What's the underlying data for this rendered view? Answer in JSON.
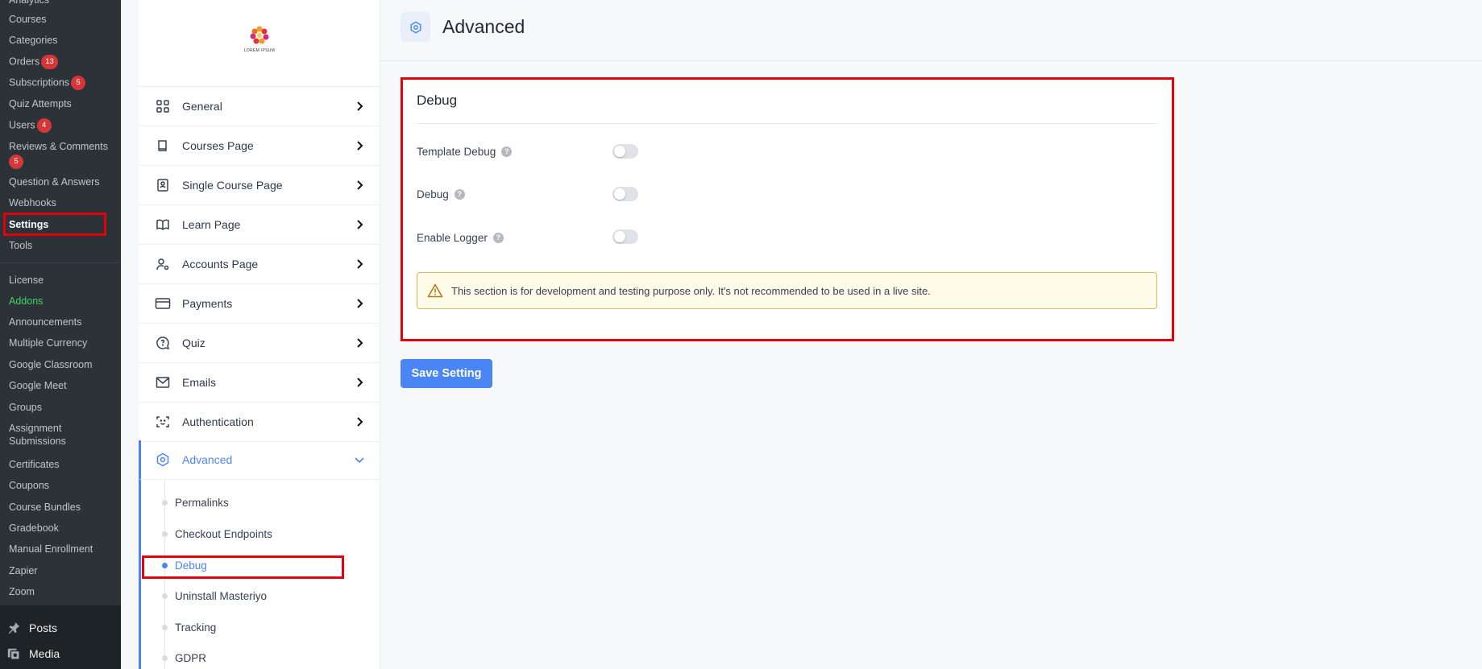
{
  "wp_menu": {
    "items": [
      {
        "label": "Analytics"
      },
      {
        "label": "Courses"
      },
      {
        "label": "Categories"
      },
      {
        "label": "Orders",
        "badge": "13"
      },
      {
        "label": "Subscriptions",
        "badge": "5"
      },
      {
        "label": "Quiz Attempts"
      },
      {
        "label": "Users",
        "badge": "4"
      },
      {
        "label": "Reviews & Comments",
        "badge": "5"
      },
      {
        "label": "Question & Answers"
      },
      {
        "label": "Webhooks"
      },
      {
        "label": "Settings"
      },
      {
        "label": "Tools"
      },
      {
        "label": "License"
      },
      {
        "label": "Addons"
      },
      {
        "label": "Announcements"
      },
      {
        "label": "Multiple Currency"
      },
      {
        "label": "Google Classroom"
      },
      {
        "label": "Google Meet"
      },
      {
        "label": "Groups"
      },
      {
        "label": "Assignment Submissions"
      },
      {
        "label": "Certificates"
      },
      {
        "label": "Coupons"
      },
      {
        "label": "Course Bundles"
      },
      {
        "label": "Gradebook"
      },
      {
        "label": "Manual Enrollment"
      },
      {
        "label": "Zapier"
      },
      {
        "label": "Zoom"
      }
    ],
    "posts": "Posts",
    "media": "Media"
  },
  "logo": {
    "text": "LOREM IPSUM"
  },
  "settings_nav": {
    "items": [
      {
        "label": "General",
        "icon": "grid-icon"
      },
      {
        "label": "Courses Page",
        "icon": "book-icon"
      },
      {
        "label": "Single Course Page",
        "icon": "course-page-icon"
      },
      {
        "label": "Learn Page",
        "icon": "open-book-icon"
      },
      {
        "label": "Accounts Page",
        "icon": "user-gear-icon"
      },
      {
        "label": "Payments",
        "icon": "credit-card-icon"
      },
      {
        "label": "Quiz",
        "icon": "quiz-bubble-icon"
      },
      {
        "label": "Emails",
        "icon": "mail-icon"
      },
      {
        "label": "Authentication",
        "icon": "face-scan-icon"
      },
      {
        "label": "Advanced",
        "icon": "hexagon-gear-icon"
      }
    ],
    "sub_items": [
      {
        "label": "Permalinks"
      },
      {
        "label": "Checkout Endpoints"
      },
      {
        "label": "Debug"
      },
      {
        "label": "Uninstall Masteriyo"
      },
      {
        "label": "Tracking"
      },
      {
        "label": "GDPR"
      }
    ]
  },
  "header": {
    "title": "Advanced"
  },
  "debug_card": {
    "title": "Debug",
    "settings": [
      {
        "label": "Template Debug",
        "enabled": false
      },
      {
        "label": "Debug",
        "enabled": false
      },
      {
        "label": "Enable Logger",
        "enabled": false
      }
    ],
    "warning": "This section is for development and testing purpose only. It's not recommended to be used in a live site."
  },
  "save_button": "Save Setting",
  "colors": {
    "accent": "#4a85f6",
    "highlight": "#e5000b",
    "badge": "#d63638",
    "addons": "#3fd463"
  }
}
